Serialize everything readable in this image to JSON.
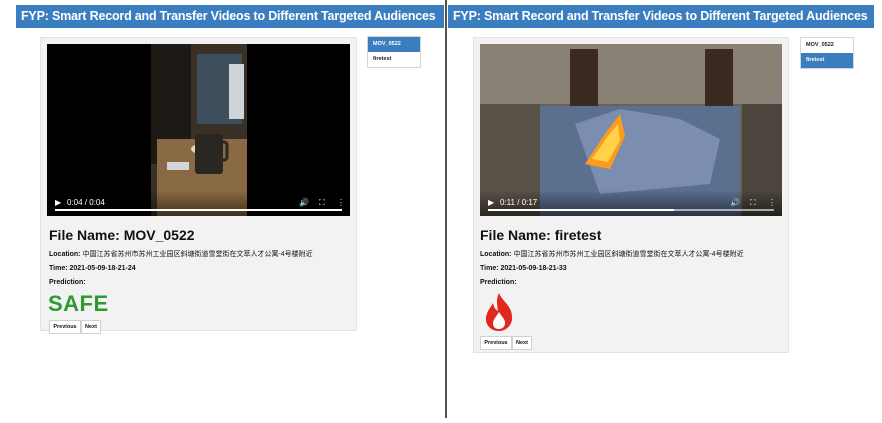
{
  "left": {
    "header_title": "FYP: Smart Record and Transfer Videos to Different Targeted Audiences",
    "video": {
      "time": "0:04 / 0:04",
      "progress": 1.0
    },
    "file_name": "File Name: MOV_0522",
    "location_label": "Location:",
    "location_value": "中国江苏省苏州市苏州工业园区斜塘街道雪堂街在文萃人才公寓-4号楼附近",
    "time_label": "Time:",
    "time_value": "2021-05-09-18-21-24",
    "prediction_label": "Prediction:",
    "prediction_value": "SAFE",
    "previous_label": "Previous",
    "next_label": "Next",
    "nav_items": [
      {
        "label": "MOV_0522",
        "active": true
      },
      {
        "label": "firetest",
        "active": false
      }
    ]
  },
  "right": {
    "header_title": "FYP: Smart Record and Transfer Videos to Different Targeted Audiences",
    "video": {
      "time": "0:11 / 0:17",
      "progress": 0.65
    },
    "file_name": "File Name: firetest",
    "location_label": "Location:",
    "location_value": "中国江苏省苏州市苏州工业园区斜塘街道雪堂街在文萃人才公寓-4号楼附近",
    "time_label": "Time:",
    "time_value": "2021-05-09-18-21-33",
    "prediction_label": "Prediction:",
    "prediction_icon": "fire-icon",
    "previous_label": "Previous",
    "next_label": "Next",
    "nav_items": [
      {
        "label": "MOV_0522",
        "active": false
      },
      {
        "label": "firetest",
        "active": true
      }
    ]
  },
  "colors": {
    "header_bg": "#3b7ec0",
    "safe_green": "#2e9b31",
    "fire_red": "#e0291d"
  }
}
